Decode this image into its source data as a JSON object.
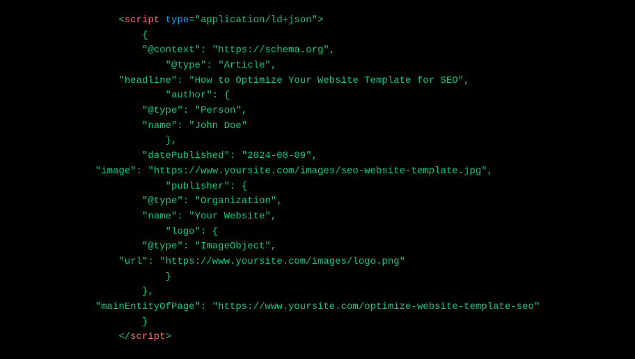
{
  "code": {
    "lines": [
      {
        "parts": [
          {
            "text": "    <",
            "class": "default"
          },
          {
            "text": "script",
            "class": "kw"
          },
          {
            "text": " type",
            "class": "tag-attr"
          },
          {
            "text": "=",
            "class": "default"
          },
          {
            "text": "\"application/ld+json\"",
            "class": "tag-val"
          },
          {
            "text": ">",
            "class": "default"
          }
        ]
      },
      {
        "parts": [
          {
            "text": "        {",
            "class": "default"
          }
        ]
      },
      {
        "parts": [
          {
            "text": "        \"@context\"",
            "class": "attr"
          },
          {
            "text": ": ",
            "class": "default"
          },
          {
            "text": "\"https://schema.org\"",
            "class": "str"
          },
          {
            "text": ",",
            "class": "default"
          }
        ]
      },
      {
        "parts": [
          {
            "text": "            \"@type\"",
            "class": "attr"
          },
          {
            "text": ": ",
            "class": "default"
          },
          {
            "text": "\"Article\"",
            "class": "str"
          },
          {
            "text": ",",
            "class": "default"
          }
        ]
      },
      {
        "parts": [
          {
            "text": "    \"headline\"",
            "class": "attr"
          },
          {
            "text": ": ",
            "class": "default"
          },
          {
            "text": "\"How to Optimize Your Website Template for SEO\"",
            "class": "str"
          },
          {
            "text": ",",
            "class": "default"
          }
        ]
      },
      {
        "parts": [
          {
            "text": "            \"author\"",
            "class": "attr"
          },
          {
            "text": ": {",
            "class": "default"
          }
        ]
      },
      {
        "parts": [
          {
            "text": "        \"@type\"",
            "class": "attr"
          },
          {
            "text": ": ",
            "class": "default"
          },
          {
            "text": "\"Person\"",
            "class": "str"
          },
          {
            "text": ",",
            "class": "default"
          }
        ]
      },
      {
        "parts": [
          {
            "text": "        \"name\"",
            "class": "attr"
          },
          {
            "text": ": ",
            "class": "default"
          },
          {
            "text": "\"John Doe\"",
            "class": "str"
          }
        ]
      },
      {
        "parts": [
          {
            "text": "            },",
            "class": "default"
          }
        ]
      },
      {
        "parts": [
          {
            "text": "        \"datePublished\"",
            "class": "attr"
          },
          {
            "text": ": ",
            "class": "default"
          },
          {
            "text": "\"2024-08-09\"",
            "class": "str"
          },
          {
            "text": ",",
            "class": "default"
          }
        ]
      },
      {
        "parts": [
          {
            "text": "\"image\"",
            "class": "attr"
          },
          {
            "text": ": ",
            "class": "default"
          },
          {
            "text": "\"https://www.yoursite.com/images/seo-website-template.jpg\"",
            "class": "str"
          },
          {
            "text": ",",
            "class": "default"
          }
        ]
      },
      {
        "parts": [
          {
            "text": "            \"publisher\"",
            "class": "attr"
          },
          {
            "text": ": {",
            "class": "default"
          }
        ]
      },
      {
        "parts": [
          {
            "text": "        \"@type\"",
            "class": "attr"
          },
          {
            "text": ": ",
            "class": "default"
          },
          {
            "text": "\"Organization\"",
            "class": "str"
          },
          {
            "text": ",",
            "class": "default"
          }
        ]
      },
      {
        "parts": [
          {
            "text": "        \"name\"",
            "class": "attr"
          },
          {
            "text": ": ",
            "class": "default"
          },
          {
            "text": "\"Your Website\"",
            "class": "str"
          },
          {
            "text": ",",
            "class": "default"
          }
        ]
      },
      {
        "parts": [
          {
            "text": "            \"logo\"",
            "class": "attr"
          },
          {
            "text": ": {",
            "class": "default"
          }
        ]
      },
      {
        "parts": [
          {
            "text": "        \"@type\"",
            "class": "attr"
          },
          {
            "text": ": ",
            "class": "default"
          },
          {
            "text": "\"ImageObject\"",
            "class": "str"
          },
          {
            "text": ",",
            "class": "default"
          }
        ]
      },
      {
        "parts": [
          {
            "text": "    \"url\"",
            "class": "attr"
          },
          {
            "text": ": ",
            "class": "default"
          },
          {
            "text": "\"https://www.yoursite.com/images/logo.png\"",
            "class": "str"
          }
        ]
      },
      {
        "parts": [
          {
            "text": "            }",
            "class": "default"
          }
        ]
      },
      {
        "parts": [
          {
            "text": "        },",
            "class": "default"
          }
        ]
      },
      {
        "parts": [
          {
            "text": "\"mainEntityOfPage\"",
            "class": "attr"
          },
          {
            "text": ": ",
            "class": "default"
          },
          {
            "text": "\"https://www.yoursite.com/optimize-website-template-seo\"",
            "class": "str"
          }
        ]
      },
      {
        "parts": [
          {
            "text": "        }",
            "class": "default"
          }
        ]
      },
      {
        "parts": [
          {
            "text": "    </",
            "class": "default"
          },
          {
            "text": "script",
            "class": "kw"
          },
          {
            "text": ">",
            "class": "default"
          }
        ]
      }
    ]
  }
}
